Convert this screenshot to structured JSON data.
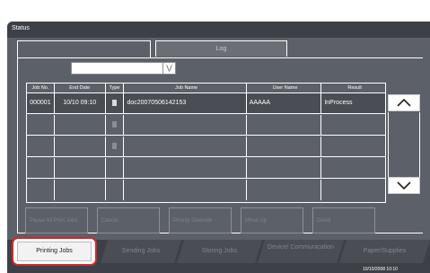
{
  "window": {
    "title": "Status"
  },
  "tabs": {
    "log": "Log"
  },
  "filter": {
    "label": "",
    "value": ""
  },
  "table": {
    "columns": [
      "Job No.",
      "End Date",
      "Type",
      "Job Name",
      "User Name",
      "Result"
    ],
    "rows": [
      {
        "job_no": "000001",
        "end_date": "10/10 09:10",
        "type_icon": "document-icon",
        "job_name": "doc20070506142153",
        "user_name": "AAAAA",
        "result": "InProcess"
      },
      {
        "job_no": "",
        "end_date": "",
        "type_icon": "document-icon",
        "job_name": "",
        "user_name": "",
        "result": ""
      },
      {
        "job_no": "",
        "end_date": "",
        "type_icon": "document-icon",
        "job_name": "",
        "user_name": "",
        "result": ""
      },
      {
        "job_no": "",
        "end_date": "",
        "type_icon": "",
        "job_name": "",
        "user_name": "",
        "result": ""
      },
      {
        "job_no": "",
        "end_date": "",
        "type_icon": "",
        "job_name": "",
        "user_name": "",
        "result": ""
      }
    ]
  },
  "actions": {
    "pause_all": "Pause All Print Jobs",
    "cancel": "Cancel",
    "priority_override": "Priority Override",
    "move_up": "Move Up",
    "detail": "Detail"
  },
  "bottom_tabs": {
    "printing": "Printing Jobs",
    "sending": "Sending Jobs",
    "storing": "Storing Jobs",
    "device": "Device/ Communication",
    "paper": "Paper/Supplies"
  },
  "status_bar": {
    "datetime": "10/10/2008  10:10"
  },
  "colors": {
    "screen_bg": "#5c6068",
    "titlebar": "#3d4047",
    "active_tab_border": "#d8242b"
  }
}
